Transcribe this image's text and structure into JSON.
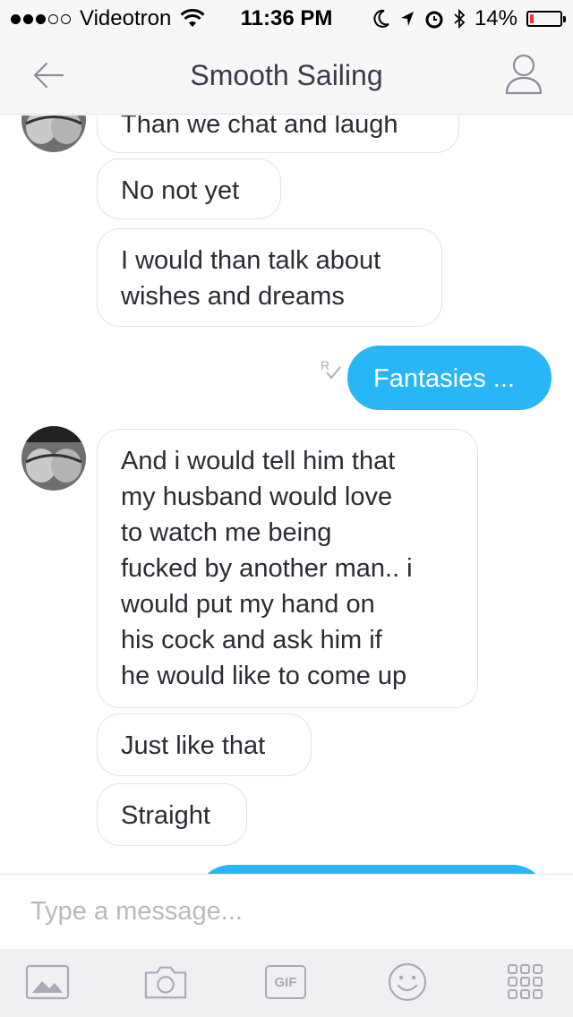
{
  "status_bar": {
    "carrier": "Videotron",
    "time": "11:36 PM",
    "battery_percent": "14%",
    "battery_level": 0.14,
    "battery_color": "#ff2d2d",
    "signal_bars_filled": 3,
    "signal_bars_total": 5,
    "icons": [
      "wifi-icon",
      "moon-icon",
      "location-arrow-icon",
      "alarm-icon",
      "bluetooth-icon",
      "battery-icon"
    ]
  },
  "nav": {
    "title": "Smooth Sailing",
    "back_icon": "back-arrow-icon",
    "profile_icon": "user-profile-icon"
  },
  "messages": [
    {
      "direction": "incoming",
      "text": "Than we chat and laugh",
      "avatar": true
    },
    {
      "direction": "incoming",
      "text": "No not yet"
    },
    {
      "direction": "incoming",
      "lines": [
        "I would than talk about",
        "wishes and dreams"
      ]
    },
    {
      "direction": "outgoing",
      "text": "Fantasies ...",
      "status_icon": "read-receipt-icon"
    },
    {
      "direction": "incoming",
      "avatar": true,
      "lines": [
        "And i would tell him that",
        "my husband would love",
        "to watch me being",
        "fucked by another man.. i",
        "would put my hand on",
        "his cock and ask him if",
        "he would like to come up"
      ]
    },
    {
      "direction": "incoming",
      "text": "Just like that"
    },
    {
      "direction": "incoming",
      "text": "Straight"
    },
    {
      "direction": "outgoing",
      "text": ""
    }
  ],
  "composer": {
    "placeholder": "Type a message..."
  },
  "toolbar": {
    "gif_label": "GIF",
    "icons": [
      "image-icon",
      "camera-icon",
      "gif-icon",
      "emoji-icon",
      "apps-grid-icon"
    ]
  },
  "colors": {
    "accent": "#29b6f6",
    "bubble_border": "#e2e2e6",
    "toolbar_icon": "#a9a9b8",
    "nav_background": "#f7f7f8"
  }
}
